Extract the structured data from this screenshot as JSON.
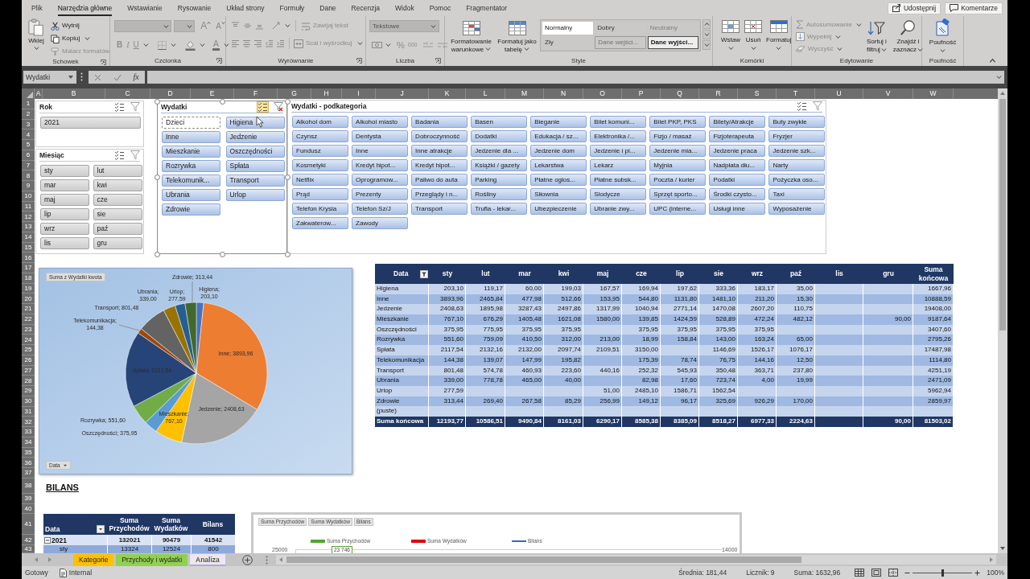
{
  "ribbon": {
    "tabs": [
      {
        "label": "Plik",
        "selected": false
      },
      {
        "label": "Narzędzia główne",
        "selected": true
      },
      {
        "label": "Wstawianie",
        "selected": false
      },
      {
        "label": "Rysowanie",
        "selected": false
      },
      {
        "label": "Układ strony",
        "selected": false
      },
      {
        "label": "Formuły",
        "selected": false
      },
      {
        "label": "Dane",
        "selected": false
      },
      {
        "label": "Recenzja",
        "selected": false
      },
      {
        "label": "Widok",
        "selected": false
      },
      {
        "label": "Pomoc",
        "selected": false
      },
      {
        "label": "Fragmentator",
        "selected": false
      }
    ],
    "actions": [
      {
        "kind": "share",
        "label": "Udostępnij"
      },
      {
        "kind": "comments",
        "label": "Komentarze"
      }
    ],
    "clipboard": {
      "title": "Schowek",
      "paste": "Wklej",
      "items": [
        {
          "kind": "cut",
          "label": "Wytnij",
          "disabled": false
        },
        {
          "kind": "copy",
          "label": "Kopiuj",
          "disabled": false
        },
        {
          "kind": "painter",
          "label": "Malarz formatów",
          "disabled": true
        }
      ]
    },
    "font": {
      "title": "Czcionka",
      "disabled": true,
      "grow": "A",
      "shrink": "A",
      "styles": [
        {
          "kind": "bold",
          "label": "B"
        },
        {
          "kind": "italic",
          "label": "I"
        },
        {
          "kind": "underline",
          "label": "U"
        }
      ],
      "color_letter": "A"
    },
    "alignment": {
      "title": "Wyrównanie",
      "items": [
        {
          "kind": "wrap",
          "label": "Zawijaj tekst",
          "disabled": true
        },
        {
          "kind": "merge",
          "label": "Scal i wyśrodkuj",
          "disabled": true
        }
      ]
    },
    "number": {
      "title": "Liczba",
      "disabled": true,
      "format": "Tekstowe",
      "symbols": [
        {
          "kind": "percent",
          "label": "%"
        },
        {
          "kind": "thousands",
          "label": "000"
        }
      ]
    },
    "styles": {
      "title": "Style",
      "buttons": [
        {
          "kind": "conditional",
          "label": "Formatowanie warunkowe"
        },
        {
          "kind": "table",
          "label": "Formatuj jako tabelę"
        }
      ],
      "gallery": [
        {
          "label": "Normalny",
          "kind": "normal",
          "selected": true
        },
        {
          "label": "Dobry",
          "kind": "good",
          "selected": false
        },
        {
          "label": "Neutralny",
          "kind": "neutral",
          "selected": false
        },
        {
          "label": "Zły",
          "kind": "bad",
          "selected": false
        },
        {
          "label": "Dane wejści...",
          "kind": "input",
          "selected": false
        },
        {
          "label": "Dane wyjści...",
          "kind": "output",
          "selected": false
        }
      ]
    },
    "cells": {
      "title": "Komórki",
      "buttons": [
        {
          "kind": "insert",
          "label": "Wstaw"
        },
        {
          "kind": "delete",
          "label": "Usuń"
        },
        {
          "kind": "format",
          "label": "Formatuj"
        }
      ]
    },
    "editing": {
      "title": "Edytowanie",
      "items": [
        {
          "kind": "autosum",
          "label": "Autosumowanie",
          "disabled": true
        },
        {
          "kind": "fill",
          "label": "Wypełnij",
          "disabled": true
        },
        {
          "kind": "clear",
          "label": "Wyczyść",
          "disabled": true
        }
      ],
      "buttons": [
        {
          "kind": "sort",
          "label": "Sortuj i filtruj"
        },
        {
          "kind": "find",
          "label": "Znajdź i zaznacz"
        }
      ]
    },
    "sensitivity": {
      "title": "Poufność",
      "button": "Poufność"
    }
  },
  "formula_bar": {
    "name_box": "Wydatki",
    "function_label": "fx"
  },
  "sheet": {
    "columns": [
      "A",
      "B",
      "C",
      "D",
      "E",
      "F",
      "G",
      "H",
      "I",
      "J",
      "K",
      "L",
      "M",
      "N",
      "O",
      "P",
      "Q",
      "R",
      "S",
      "T",
      "U",
      "V",
      "W"
    ],
    "rows": [
      "1",
      "2",
      "3",
      "4",
      "5",
      "6",
      "7",
      "8",
      "9",
      "10",
      "11",
      "12",
      "13",
      "14",
      "15",
      "16",
      "17",
      "18",
      "19",
      "20",
      "21",
      "22",
      "23",
      "24",
      "25",
      "26",
      "27",
      "28",
      "29",
      "30",
      "31",
      "32",
      "33",
      "34",
      "35",
      "36",
      "37",
      "38",
      "39",
      "40",
      "41",
      "42",
      "43"
    ]
  },
  "slicers": [
    {
      "title": "Rok",
      "kind": "plain",
      "active": false,
      "multi_select": false,
      "filtered": false,
      "items": [
        {
          "label": "2021",
          "selected": true
        }
      ]
    },
    {
      "title": "Miesiąc",
      "kind": "plain",
      "active": false,
      "multi_select": false,
      "filtered": false,
      "items": [
        {
          "label": "sty",
          "selected": true
        },
        {
          "label": "lut",
          "selected": true
        },
        {
          "label": "mar",
          "selected": true
        },
        {
          "label": "kwi",
          "selected": true
        },
        {
          "label": "maj",
          "selected": true
        },
        {
          "label": "cze",
          "selected": true
        },
        {
          "label": "lip",
          "selected": true
        },
        {
          "label": "sie",
          "selected": true
        },
        {
          "label": "wrz",
          "selected": true
        },
        {
          "label": "paź",
          "selected": true
        },
        {
          "label": "lis",
          "selected": true
        },
        {
          "label": "gru",
          "selected": true
        }
      ]
    },
    {
      "title": "Wydatki",
      "kind": "accent",
      "active": true,
      "multi_select": true,
      "filtered": true,
      "items": [
        {
          "label": "Dzieci",
          "selected": false
        },
        {
          "label": "Higiena",
          "selected": true
        },
        {
          "label": "Inne",
          "selected": true
        },
        {
          "label": "Jedzenie",
          "selected": true
        },
        {
          "label": "Mieszkanie",
          "selected": true
        },
        {
          "label": "Oszczędności",
          "selected": true
        },
        {
          "label": "Rozrywka",
          "selected": true
        },
        {
          "label": "Spłata",
          "selected": true
        },
        {
          "label": "Telekomunik...",
          "selected": true
        },
        {
          "label": "Transport",
          "selected": true
        },
        {
          "label": "Ubrania",
          "selected": true
        },
        {
          "label": "Urlop",
          "selected": true
        },
        {
          "label": "Zdrowie",
          "selected": true
        }
      ]
    },
    {
      "title": "Wydatki - podkategoria",
      "kind": "accent",
      "active": false,
      "multi_select": false,
      "filtered": false,
      "items": [
        {
          "label": "Alkohol dom",
          "selected": true
        },
        {
          "label": "Alkohol miasto",
          "selected": true
        },
        {
          "label": "Badania",
          "selected": true
        },
        {
          "label": "Basen",
          "selected": true
        },
        {
          "label": "Bieganie",
          "selected": true
        },
        {
          "label": "Bilet komuni...",
          "selected": true
        },
        {
          "label": "Bilet PKP, PKS",
          "selected": true
        },
        {
          "label": "Bilety/Atrakcje",
          "selected": true
        },
        {
          "label": "Buty zwykłe",
          "selected": true
        },
        {
          "label": "Czynsz",
          "selected": true
        },
        {
          "label": "Dentysta",
          "selected": true
        },
        {
          "label": "Dobroczynność",
          "selected": true
        },
        {
          "label": "Dodatki",
          "selected": true
        },
        {
          "label": "Edukacja / sz...",
          "selected": true
        },
        {
          "label": "Elektronika /...",
          "selected": true
        },
        {
          "label": "Fizjo / masaż",
          "selected": true
        },
        {
          "label": "Fizjoterapeuta",
          "selected": true
        },
        {
          "label": "Fryzjer",
          "selected": true
        },
        {
          "label": "Fundusz",
          "selected": true
        },
        {
          "label": "Inne",
          "selected": true
        },
        {
          "label": "Inne atrakcje",
          "selected": true
        },
        {
          "label": "Jedzenie dla ...",
          "selected": true
        },
        {
          "label": "Jedzenie dom",
          "selected": true
        },
        {
          "label": "Jedzenie i pi...",
          "selected": true
        },
        {
          "label": "Jedzenie mia...",
          "selected": true
        },
        {
          "label": "Jedzenie praca",
          "selected": true
        },
        {
          "label": "Jedzenie szk...",
          "selected": true
        },
        {
          "label": "Kosmetyki",
          "selected": true
        },
        {
          "label": "Kredyt hipot...",
          "selected": true
        },
        {
          "label": "Kredyt hipot...",
          "selected": true
        },
        {
          "label": "Książki / gazety",
          "selected": true
        },
        {
          "label": "Lekarstwa",
          "selected": true
        },
        {
          "label": "Lekarz",
          "selected": true
        },
        {
          "label": "Myjnia",
          "selected": true
        },
        {
          "label": "Nadpłata dłu...",
          "selected": true
        },
        {
          "label": "Narty",
          "selected": true
        },
        {
          "label": "Netflix",
          "selected": true
        },
        {
          "label": "Oprogramow...",
          "selected": true
        },
        {
          "label": "Paliwo do auta",
          "selected": true
        },
        {
          "label": "Parking",
          "selected": true
        },
        {
          "label": "Płatne ogłos...",
          "selected": true
        },
        {
          "label": "Płatne subsk...",
          "selected": true
        },
        {
          "label": "Poczta / kurier",
          "selected": true
        },
        {
          "label": "Podatki",
          "selected": true
        },
        {
          "label": "Pożyczka oso...",
          "selected": true
        },
        {
          "label": "Prąd",
          "selected": true
        },
        {
          "label": "Prezenty",
          "selected": true
        },
        {
          "label": "Przeglądy i n...",
          "selected": true
        },
        {
          "label": "Rośliny",
          "selected": true
        },
        {
          "label": "Siłownia",
          "selected": true
        },
        {
          "label": "Słodycze",
          "selected": true
        },
        {
          "label": "Sprzęt sporto...",
          "selected": true
        },
        {
          "label": "Środki czysto...",
          "selected": true
        },
        {
          "label": "Taxi",
          "selected": true
        },
        {
          "label": "Telefon Krysia",
          "selected": true
        },
        {
          "label": "Telefon Sz/J",
          "selected": true
        },
        {
          "label": "Transport",
          "selected": true
        },
        {
          "label": "Trufla - lekar...",
          "selected": true
        },
        {
          "label": "Ubezpieczenie",
          "selected": true
        },
        {
          "label": "Ubranie zwy...",
          "selected": true
        },
        {
          "label": "UPC (interne...",
          "selected": true
        },
        {
          "label": "Usługi inne",
          "selected": true
        },
        {
          "label": "Wyposażenie",
          "selected": true
        },
        {
          "label": "Zakwaterow...",
          "selected": true
        },
        {
          "label": "Zawody",
          "selected": true
        }
      ]
    }
  ],
  "pie_chart": {
    "value_field": "Suma z Wydatki kwota",
    "axis_field": "Data",
    "chart_data": {
      "type": "pie",
      "values": [
        203.1,
        3893.96,
        2408.63,
        767.1,
        375.95,
        551.6,
        2117.54,
        144.38,
        801.48,
        339.0,
        277.59,
        313.44
      ],
      "value_labels": [
        "Higiena; 203,10",
        "Inne; 3893,96",
        "Jedzenie; 2408,63",
        "Mieszkanie; 767,10",
        "Oszczędności; 375,95",
        "Rozrywka; 551,60",
        "Spłata; 2117,54",
        "Telekomunikacja; 144,38",
        "Transport; 801,48",
        "Ubrania; 339,00",
        "Urlop; 277,59",
        "Zdrowie; 313,44"
      ]
    }
  },
  "pivot_table": {
    "filtered": true,
    "columns": [
      "Data",
      "sty",
      "lut",
      "mar",
      "kwi",
      "maj",
      "cze",
      "lip",
      "sie",
      "wrz",
      "paź",
      "lis",
      "gru",
      "Suma końcowa"
    ],
    "rows": [
      {
        "kind": "item",
        "cells": [
          "Higiena",
          "203,10",
          "119,17",
          "60,00",
          "199,03",
          "167,57",
          "169,94",
          "197,62",
          "333,36",
          "183,17",
          "35,00",
          null,
          null,
          "1667,96"
        ]
      },
      {
        "kind": "item",
        "cells": [
          "Inne",
          "3893,96",
          "2465,84",
          "477,98",
          "512,66",
          "153,95",
          "544,80",
          "1131,80",
          "1481,10",
          "211,20",
          "15,30",
          null,
          null,
          "10888,59"
        ]
      },
      {
        "kind": "item",
        "cells": [
          "Jedzenie",
          "2408,63",
          "1895,98",
          "3287,43",
          "2497,86",
          "1317,99",
          "1040,94",
          "2771,14",
          "1470,08",
          "2607,20",
          "110,75",
          null,
          null,
          "19408,00"
        ]
      },
      {
        "kind": "item",
        "cells": [
          "Mieszkanie",
          "767,10",
          "676,29",
          "1405,48",
          "1621,08",
          "1580,00",
          "139,85",
          "1424,59",
          "528,89",
          "472,24",
          "482,12",
          null,
          "90,00",
          "9187,64"
        ]
      },
      {
        "kind": "item",
        "cells": [
          "Oszczędności",
          "375,95",
          "775,95",
          "375,95",
          "375,95",
          null,
          "375,95",
          "375,95",
          "375,95",
          "375,95",
          null,
          null,
          null,
          "3407,60"
        ]
      },
      {
        "kind": "item",
        "cells": [
          "Rozrywka",
          "551,60",
          "759,09",
          "410,50",
          "312,00",
          "213,00",
          "18,99",
          "158,84",
          "143,00",
          "163,24",
          "65,00",
          null,
          null,
          "2795,26"
        ]
      },
      {
        "kind": "item",
        "cells": [
          "Spłata",
          "2117,54",
          "2132,16",
          "2132,00",
          "2097,74",
          "2109,51",
          "3150,00",
          null,
          "1146,69",
          "1526,17",
          "1076,17",
          null,
          null,
          "17487,98"
        ]
      },
      {
        "kind": "item",
        "cells": [
          "Telekomunikacja",
          "144,38",
          "139,07",
          "147,99",
          "195,82",
          null,
          "175,39",
          "78,74",
          "76,75",
          "144,16",
          "12,50",
          null,
          null,
          "1114,80"
        ]
      },
      {
        "kind": "item",
        "cells": [
          "Transport",
          "801,48",
          "574,78",
          "460,93",
          "223,60",
          "440,16",
          "252,32",
          "545,93",
          "350,48",
          "363,71",
          "237,80",
          null,
          null,
          "4251,19"
        ]
      },
      {
        "kind": "item",
        "cells": [
          "Ubrania",
          "339,00",
          "778,78",
          "465,00",
          "40,00",
          null,
          "82,98",
          "17,60",
          "723,74",
          "4,00",
          "19,99",
          null,
          null,
          "2471,09"
        ]
      },
      {
        "kind": "item",
        "cells": [
          "Urlop",
          "277,59",
          null,
          null,
          null,
          "51,00",
          "2485,10",
          "1586,71",
          "1562,54",
          null,
          null,
          null,
          null,
          "5962,94"
        ]
      },
      {
        "kind": "item",
        "cells": [
          "Zdrowie",
          "313,44",
          "269,40",
          "267,58",
          "85,29",
          "256,99",
          "149,12",
          "96,17",
          "325,69",
          "926,29",
          "170,00",
          null,
          null,
          "2859,97"
        ]
      },
      {
        "kind": "item",
        "cells": [
          "(puste)",
          null,
          null,
          null,
          null,
          null,
          null,
          null,
          null,
          null,
          null,
          null,
          null,
          null
        ]
      },
      {
        "kind": "total",
        "cells": [
          "Suma końcowa",
          "12193,77",
          "10586,51",
          "9490,84",
          "8161,03",
          "6290,17",
          "8585,38",
          "8385,09",
          "8518,27",
          "6977,33",
          "2224,63",
          null,
          "90,00",
          "81503,02"
        ]
      }
    ]
  },
  "bilans": {
    "heading": "BILANS",
    "table": {
      "filtered": false,
      "columns": [
        "Data",
        "Suma Przychodów",
        "Suma Wydatków",
        "Bilans"
      ],
      "rows": [
        {
          "kind": "group",
          "expanded": true,
          "cells": [
            "2021",
            "132021",
            "90479",
            "41542"
          ]
        },
        {
          "kind": "item",
          "cells": [
            "sty",
            "13324",
            "12524",
            "800"
          ]
        }
      ]
    },
    "chart": {
      "field_buttons": [
        "Suma Przychodów",
        "Suma Wydatków",
        "Bilans"
      ],
      "legend": [
        {
          "label": "Suma Przychodów",
          "kind": "bar",
          "color": "#4ea72e"
        },
        {
          "label": "Suma Wydatków",
          "kind": "bar",
          "color": "#e00000"
        },
        {
          "label": "Bilans",
          "kind": "line",
          "color": "#2f6eba"
        }
      ],
      "left_tick": "25000",
      "right_tick": "14000",
      "data_label": "23 746"
    }
  },
  "sheet_tabs": [
    {
      "label": "Kategorie",
      "color": "#ffc000",
      "selected": false
    },
    {
      "label": "Przychody i wydatki",
      "color": "#92d050",
      "selected": false
    },
    {
      "label": "Analiza",
      "color": "#b4a7d6",
      "selected": true
    }
  ],
  "status_bar": {
    "mode": "Gotowy",
    "label": "Internal",
    "stats": [
      "Średnia: 181,44",
      "Licznik: 9",
      "Suma: 1632,96"
    ],
    "zoom_slider": {
      "level": 0.5
    },
    "zoom": "100%"
  }
}
